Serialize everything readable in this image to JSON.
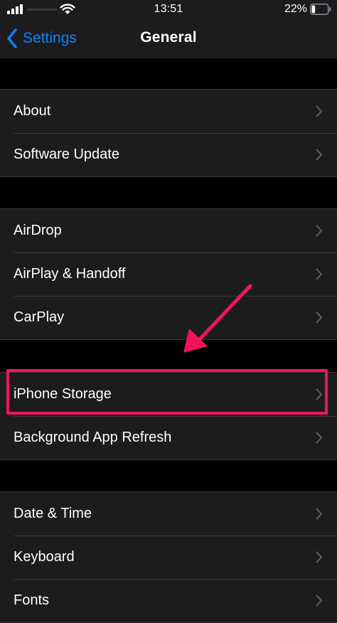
{
  "status_bar": {
    "time": "13:51",
    "battery_percent": "22%",
    "battery_level": 0.22,
    "icons": [
      "signal-icon",
      "wifi-icon",
      "battery-icon"
    ]
  },
  "nav": {
    "back_label": "Settings",
    "title": "General",
    "back_icon": "chevron-left-icon"
  },
  "sections": [
    {
      "items": [
        {
          "label": "About"
        },
        {
          "label": "Software Update"
        }
      ]
    },
    {
      "items": [
        {
          "label": "AirDrop"
        },
        {
          "label": "AirPlay & Handoff"
        },
        {
          "label": "CarPlay"
        }
      ]
    },
    {
      "items": [
        {
          "label": "iPhone Storage"
        },
        {
          "label": "Background App Refresh"
        }
      ]
    },
    {
      "items": [
        {
          "label": "Date & Time"
        },
        {
          "label": "Keyboard"
        },
        {
          "label": "Fonts"
        }
      ]
    }
  ],
  "annotation": {
    "color": "#f2135b",
    "target": "iPhone Storage"
  },
  "colors": {
    "accent": "#0a84ff",
    "background": "#000000",
    "cell": "#1c1c1e",
    "separator": "#38383a",
    "chevron": "#5a5a5e"
  }
}
